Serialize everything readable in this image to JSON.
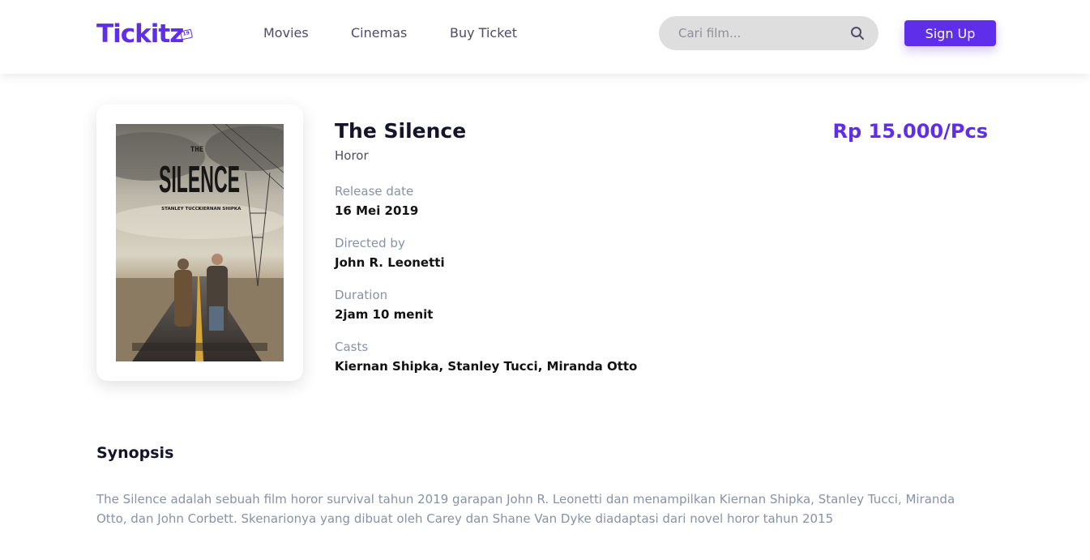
{
  "header": {
    "logo_text": "Tickitz",
    "logo_badge": "19",
    "nav": [
      "Movies",
      "Cinemas",
      "Buy Ticket"
    ],
    "search_placeholder": "Cari film...",
    "signup_label": "Sign Up"
  },
  "movie": {
    "title": "The Silence",
    "genre": "Horor",
    "price": "Rp 15.000/Pcs",
    "release_label": "Release date",
    "release_value": "16 Mei 2019",
    "director_label": "Directed by",
    "director_value": "John R. Leonetti",
    "duration_label": "Duration",
    "duration_value": "2jam 10 menit",
    "casts_label": "Casts",
    "casts_value": "Kiernan Shipka, Stanley Tucci, Miranda Otto"
  },
  "poster": {
    "top_word": "THE",
    "main_word": "SILENCE",
    "actor_1": "STANLEY TUCCI",
    "actor_2": "KIERNAN SHIPKA"
  },
  "synopsis": {
    "title": "Synopsis",
    "text": "The Silence adalah sebuah film horor survival tahun 2019 garapan John R. Leonetti dan menampilkan Kiernan Shipka, Stanley Tucci, Miranda Otto, dan John Corbett. Skenarionya yang dibuat oleh Carey dan Shane Van Dyke diadaptasi dari novel horor tahun 2015"
  },
  "colors": {
    "brand": "#5f2eea",
    "label": "#8692a6",
    "search_bg": "#dedede"
  }
}
